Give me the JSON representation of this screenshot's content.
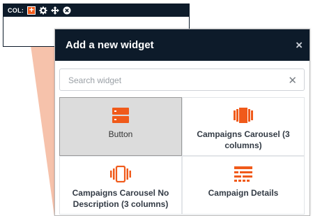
{
  "column_toolbar": {
    "label": "COL:",
    "add_symbol": "+",
    "icons": [
      "add-icon",
      "gear-icon",
      "move-icon",
      "close-icon"
    ]
  },
  "modal": {
    "title": "Add a new widget",
    "close_symbol": "×",
    "search": {
      "placeholder": "Search widget",
      "value": "",
      "clear_symbol": "✕"
    },
    "widgets": [
      {
        "label": "Button",
        "icon": "button-widget-icon",
        "selected": true
      },
      {
        "label": "Campaigns Carousel (3 columns)",
        "icon": "carousel-icon",
        "selected": false
      },
      {
        "label": "Campaigns Carousel No Description (3 columns)",
        "icon": "carousel-no-description-icon",
        "selected": false
      },
      {
        "label": "Campaign Details",
        "icon": "campaign-details-icon",
        "selected": false
      }
    ]
  },
  "colors": {
    "header_bg": "#0d1b2a",
    "accent": "#f05a1a",
    "connector": "#f6c2ab",
    "selected_tile": "#dcdcdc"
  }
}
